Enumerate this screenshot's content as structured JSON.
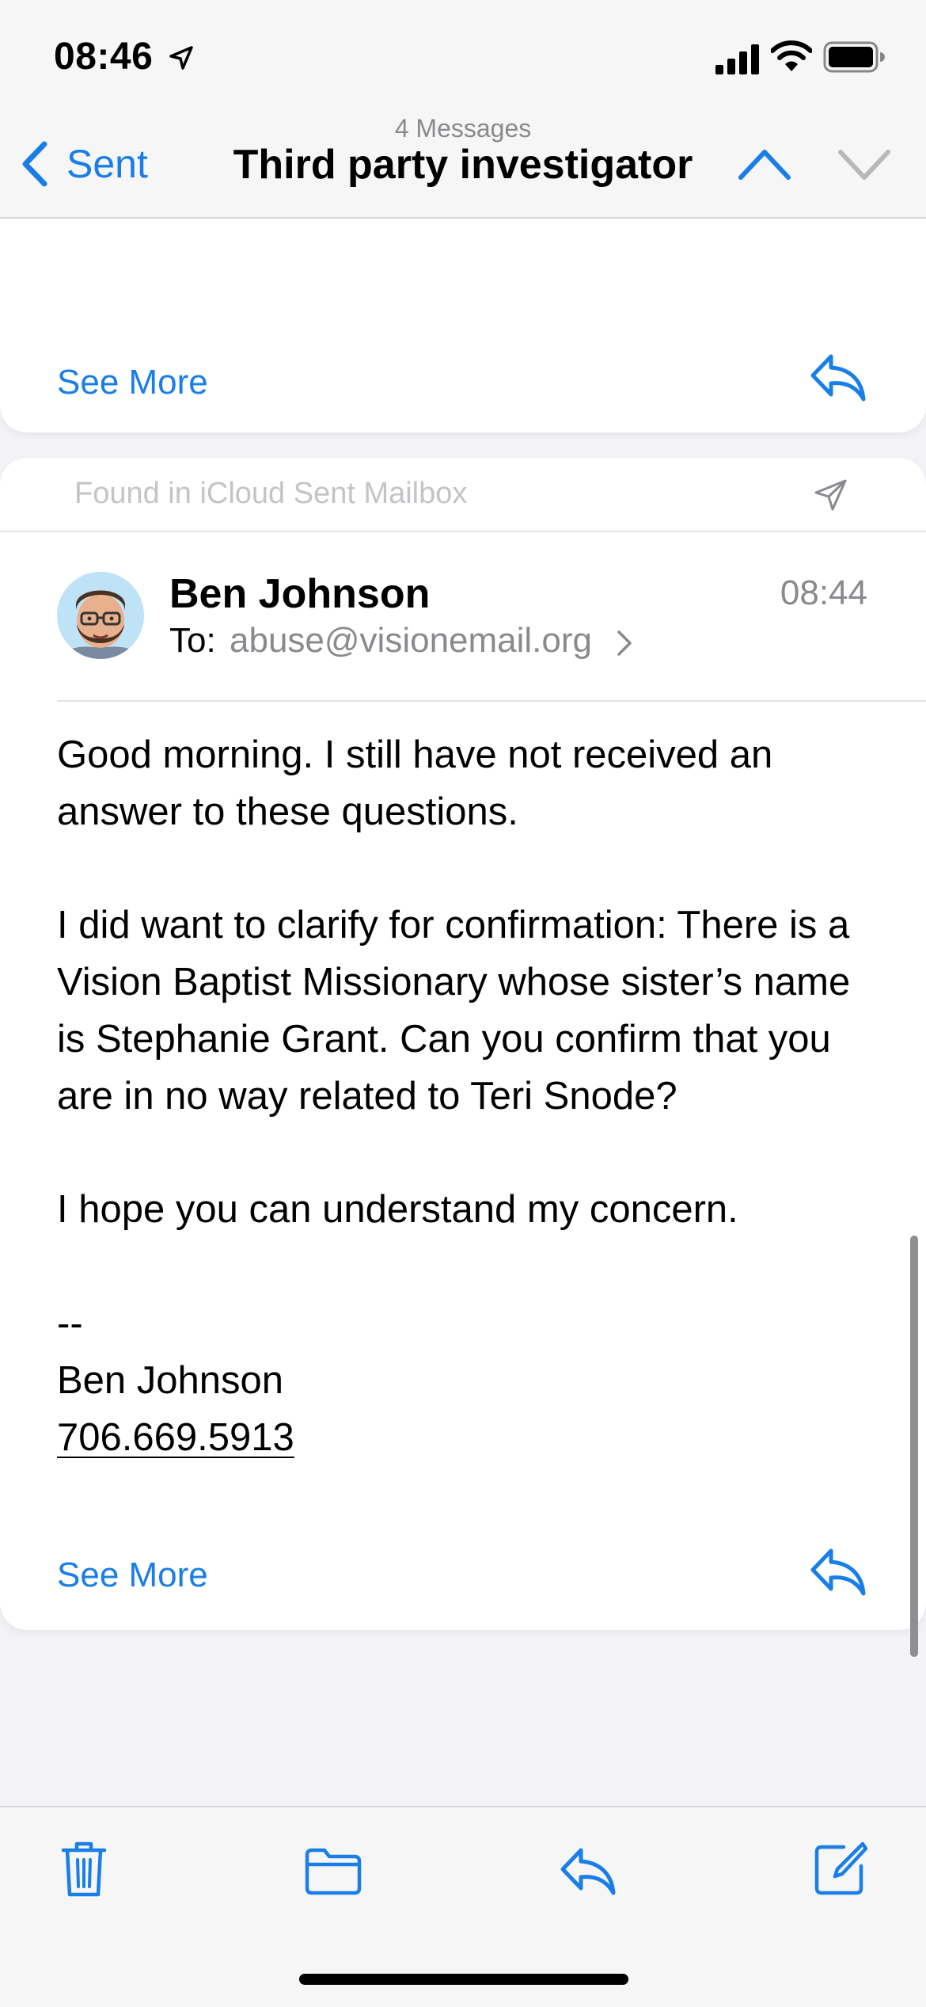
{
  "status_bar": {
    "time": "08:46",
    "icons": [
      "location-arrow-icon",
      "cellular-signal-icon",
      "wifi-icon",
      "battery-icon"
    ]
  },
  "nav": {
    "back_label": "Sent",
    "message_count": "4 Messages",
    "title": "Third party investigator",
    "icons": [
      "back-chevron-icon",
      "previous-message-chevron-up-icon",
      "next-message-chevron-down-icon"
    ]
  },
  "previous_message": {
    "see_more_label": "See More"
  },
  "message": {
    "found_in": "Found in iCloud Sent Mailbox",
    "sender": "Ben Johnson",
    "time": "08:44",
    "to_label": "To:",
    "to_address": "abuse@visionemail.org",
    "body": [
      "Good morning. I still have not received an answer to these questions.",
      "",
      "I did want to clarify for confirmation: There is a Vision Baptist Missionary whose sister’s name is Stephanie Grant. Can you confirm that you are in no way related to Teri Snode?",
      "",
      "I hope you can understand my concern.",
      "",
      "--",
      "Ben Johnson"
    ],
    "phone": "706.669.5913",
    "see_more_label": "See More"
  },
  "toolbar": {
    "icons": [
      "trash-icon",
      "folder-icon",
      "reply-icon",
      "compose-icon"
    ]
  },
  "colors": {
    "accent": "#1a7ee8",
    "background": "#f2f2f7",
    "card": "#ffffff",
    "secondary_text": "#8a8a8e"
  }
}
